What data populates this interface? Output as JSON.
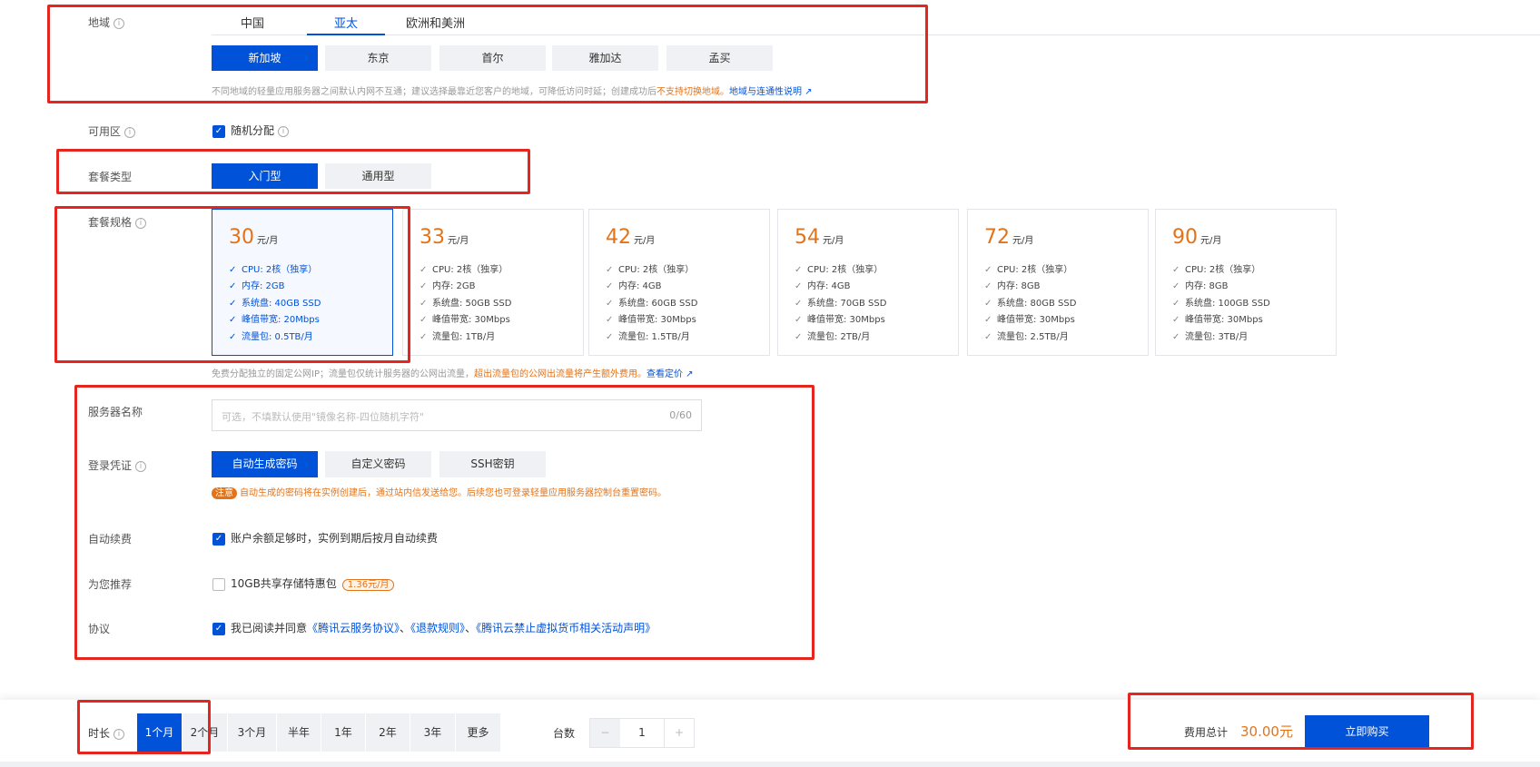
{
  "region": {
    "label": "地域",
    "tabs": [
      "中国",
      "亚太",
      "欧洲和美洲"
    ],
    "active_tab": 1,
    "cities": [
      "新加坡",
      "东京",
      "首尔",
      "雅加达",
      "孟买"
    ],
    "selected_city": 0,
    "note": "不同地域的轻量应用服务器之间默认内网不互通；建议选择最靠近您客户的地域，可降低访问时延；创建成功后",
    "note_warn": "不支持切换地域。",
    "note_link": "地域与连通性说明"
  },
  "zone": {
    "label": "可用区",
    "checkbox_label": "随机分配",
    "checked": true
  },
  "plan_type": {
    "label": "套餐类型",
    "options": [
      "入门型",
      "通用型"
    ],
    "selected": 0
  },
  "plan_spec": {
    "label": "套餐规格",
    "unit": "元/月",
    "selected": 0,
    "cards": [
      {
        "price": "30",
        "specs": [
          "CPU: 2核（独享）",
          "内存: 2GB",
          "系统盘: 40GB SSD",
          "峰值带宽: 20Mbps",
          "流量包: 0.5TB/月"
        ]
      },
      {
        "price": "33",
        "specs": [
          "CPU: 2核（独享）",
          "内存: 2GB",
          "系统盘: 50GB SSD",
          "峰值带宽: 30Mbps",
          "流量包: 1TB/月"
        ]
      },
      {
        "price": "42",
        "specs": [
          "CPU: 2核（独享）",
          "内存: 4GB",
          "系统盘: 60GB SSD",
          "峰值带宽: 30Mbps",
          "流量包: 1.5TB/月"
        ]
      },
      {
        "price": "54",
        "specs": [
          "CPU: 2核（独享）",
          "内存: 4GB",
          "系统盘: 70GB SSD",
          "峰值带宽: 30Mbps",
          "流量包: 2TB/月"
        ]
      },
      {
        "price": "72",
        "specs": [
          "CPU: 2核（独享）",
          "内存: 8GB",
          "系统盘: 80GB SSD",
          "峰值带宽: 30Mbps",
          "流量包: 2.5TB/月"
        ]
      },
      {
        "price": "90",
        "specs": [
          "CPU: 2核（独享）",
          "内存: 8GB",
          "系统盘: 100GB SSD",
          "峰值带宽: 30Mbps",
          "流量包: 3TB/月"
        ]
      }
    ],
    "note": "免费分配独立的固定公网IP；流量包仅统计服务器的公网出流量，",
    "note_warn": "超出流量包的公网出流量将产生额外费用。",
    "note_link": "查看定价"
  },
  "server_name": {
    "label": "服务器名称",
    "placeholder": "可选，不填默认使用\"镜像名称-四位随机字符\"",
    "counter": "0/60"
  },
  "login": {
    "label": "登录凭证",
    "options": [
      "自动生成密码",
      "自定义密码",
      "SSH密钥"
    ],
    "selected": 0,
    "notice_badge": "注意",
    "notice": "自动生成的密码将在实例创建后，通过站内信发送给您。后续您也可登录轻量应用服务器控制台重置密码。"
  },
  "auto_renew": {
    "label": "自动续费",
    "text": "账户余额足够时，实例到期后按月自动续费",
    "checked": true
  },
  "recommend": {
    "label": "为您推荐",
    "text": "10GB共享存储特惠包",
    "price_badge": "1.36元/月",
    "checked": false
  },
  "agreement": {
    "label": "协议",
    "text": "我已阅读并同意",
    "links": [
      "《腾讯云服务协议》",
      "《退款规则》",
      "《腾讯云禁止虚拟货币相关活动声明》"
    ],
    "sep": "、",
    "checked": true
  },
  "footer": {
    "duration_label": "时长",
    "durations": [
      "1个月",
      "2个月",
      "3个月",
      "半年",
      "1年",
      "2年",
      "3年",
      "更多"
    ],
    "selected": 0,
    "quantity_label": "台数",
    "quantity": "1",
    "minus": "−",
    "plus": "+",
    "total_label": "费用总计",
    "total": "30.00元",
    "buy": "立即购买"
  },
  "colors": {
    "primary": "#0052d9",
    "warning": "#e37318",
    "highlight": "#e5261e"
  }
}
